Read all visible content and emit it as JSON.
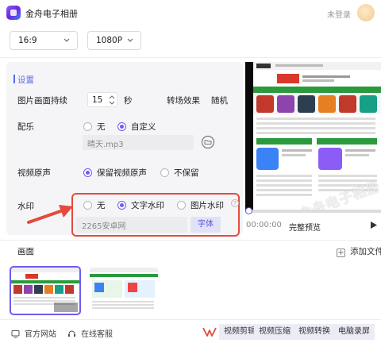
{
  "app": {
    "title": "金舟电子相册",
    "login": "未登录"
  },
  "top": {
    "ratio": "16:9",
    "resolution": "1080P"
  },
  "settings": {
    "title": "设置",
    "duration_label": "图片画面持续",
    "duration_value": "15",
    "duration_unit": "秒",
    "transition_label": "转场效果",
    "transition_value": "随机",
    "music_label": "配乐",
    "music_none": "无",
    "music_custom": "自定义",
    "music_file": "晴天.mp3",
    "audio_label": "视频原声",
    "audio_keep": "保留视频原声",
    "audio_drop": "不保留",
    "wm_label": "水印",
    "wm_none": "无",
    "wm_text": "文字水印",
    "wm_image": "图片水印",
    "wm_placeholder": "2265安卓网",
    "wm_font_btn": "字体"
  },
  "preview": {
    "watermark_overlay": "金舟电子相册",
    "time": "00:00:00",
    "full_preview": "完整预览"
  },
  "canvas": {
    "label": "画面",
    "add_file": "添加文件"
  },
  "footer": {
    "website": "官方网站",
    "support": "在线客服",
    "video_edit": "视频剪辑",
    "video_compress": "视频压缩",
    "video_convert": "视频转换",
    "screen_record": "电脑录屏"
  },
  "colors": {
    "accent": "#6d5cf0",
    "highlight_red": "#e54a3c",
    "panel_bg": "#f5f5f7"
  },
  "icons": [
    "app-logo-icon",
    "chevron-down-icon",
    "folder-icon",
    "help-icon",
    "play-icon",
    "plus-icon",
    "monitor-icon",
    "headset-icon",
    "arrow-icon"
  ]
}
